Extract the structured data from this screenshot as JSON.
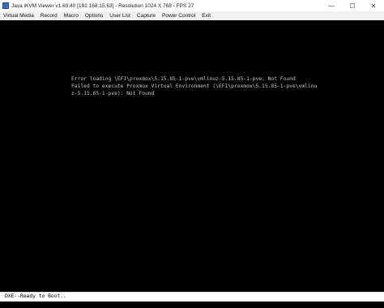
{
  "window": {
    "title": "Java iKVM Viewer v1.69.40 [192.168.15.63]  - Resolution 1024 X 768 - FPS 27",
    "controls": {
      "minimize": "—",
      "maximize": "☐",
      "close": "✕"
    }
  },
  "menu": {
    "items": [
      "Virtual Media",
      "Record",
      "Macro",
      "Options",
      "User List",
      "Capture",
      "Power Control",
      "Exit"
    ]
  },
  "console": {
    "lines": [
      "Error loading \\EFI\\proxmox\\5.15.85-1-pve\\vmlinuz-5.15.85-1-pve: Not Found",
      "Failed to execute Proxmox Virtual Environment (\\EFI\\proxmox\\5.15.85-1-pve\\vmlinu",
      "z-5.15.85-1-pve): Not Found"
    ]
  },
  "status": {
    "text": "DXE--Ready to Boot.."
  },
  "colors": {
    "screen_background": "#000000",
    "console_text": "#c8c8c8",
    "menubar_background": "#f0f0f0"
  }
}
